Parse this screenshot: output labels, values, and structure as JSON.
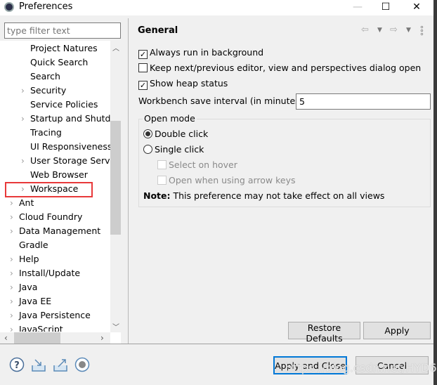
{
  "window": {
    "title": "Preferences",
    "minimize": "—",
    "maximize": "☐",
    "close": "✕"
  },
  "filter": {
    "placeholder": "type filter text"
  },
  "tree": {
    "items": [
      {
        "label": "Project Natures",
        "level": 1,
        "expandable": false
      },
      {
        "label": "Quick Search",
        "level": 1,
        "expandable": false
      },
      {
        "label": "Search",
        "level": 1,
        "expandable": false
      },
      {
        "label": "Security",
        "level": 1,
        "expandable": true
      },
      {
        "label": "Service Policies",
        "level": 1,
        "expandable": false
      },
      {
        "label": "Startup and Shutdown",
        "level": 1,
        "expandable": true
      },
      {
        "label": "Tracing",
        "level": 1,
        "expandable": false
      },
      {
        "label": "UI Responsiveness",
        "level": 1,
        "expandable": false
      },
      {
        "label": "User Storage Service",
        "level": 1,
        "expandable": true
      },
      {
        "label": "Web Browser",
        "level": 1,
        "expandable": false
      },
      {
        "label": "Workspace",
        "level": 1,
        "expandable": true,
        "highlighted": true
      },
      {
        "label": "Ant",
        "level": 0,
        "expandable": true
      },
      {
        "label": "Cloud Foundry",
        "level": 0,
        "expandable": true
      },
      {
        "label": "Data Management",
        "level": 0,
        "expandable": true
      },
      {
        "label": "Gradle",
        "level": 0,
        "expandable": false
      },
      {
        "label": "Help",
        "level": 0,
        "expandable": true
      },
      {
        "label": "Install/Update",
        "level": 0,
        "expandable": true
      },
      {
        "label": "Java",
        "level": 0,
        "expandable": true
      },
      {
        "label": "Java EE",
        "level": 0,
        "expandable": true
      },
      {
        "label": "Java Persistence",
        "level": 0,
        "expandable": true
      },
      {
        "label": "JavaScript",
        "level": 0,
        "expandable": true
      }
    ],
    "highlight_color": "#e8393a"
  },
  "page": {
    "title": "General",
    "always_run_bg": {
      "label": "Always run in background",
      "checked": true
    },
    "keep_dialog": {
      "label": "Keep next/previous editor, view and perspectives dialog open",
      "checked": false
    },
    "show_heap": {
      "label": "Show heap status",
      "checked": true
    },
    "interval_label": "Workbench save interval (in minutes):",
    "interval_value": "5",
    "open_mode": {
      "label": "Open mode",
      "double_click": "Double click",
      "single_click": "Single click",
      "selected": "Double click",
      "select_on_hover": "Select on hover",
      "open_arrow_keys": "Open when using arrow keys",
      "note_bold": "Note:",
      "note_text": " This preference may not take effect on all views"
    },
    "restore_defaults": "Restore Defaults",
    "apply": "Apply"
  },
  "footer": {
    "apply_close": "Apply and Close",
    "cancel": "Cancel",
    "watermark": "https://blog.csdn.net/HYD696"
  }
}
